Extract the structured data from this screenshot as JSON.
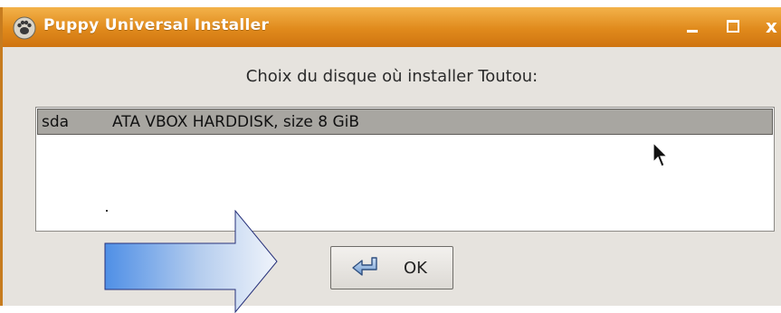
{
  "window": {
    "title": "Puppy Universal Installer",
    "controls": {
      "minimize": "_",
      "maximize": "□",
      "close": "x"
    }
  },
  "dialog": {
    "prompt": "Choix du disque où installer Toutou:",
    "disks": [
      {
        "device": "sda",
        "description": "ATA VBOX HARDDISK,  size 8 GiB",
        "selected": true
      }
    ],
    "ok_label": "OK"
  },
  "icons": {
    "app": "puppy-paw-icon",
    "ok": "enter-arrow-icon",
    "pointer": "mouse-pointer-icon",
    "annotation": "right-arrow-annotation"
  },
  "colors": {
    "titlebar": "#e08a1c",
    "dialog_bg": "#e6e3de",
    "selected_row": "#a8a6a1",
    "arrow_fill_start": "#4f8fe6",
    "arrow_fill_end": "#f0f4fb"
  }
}
